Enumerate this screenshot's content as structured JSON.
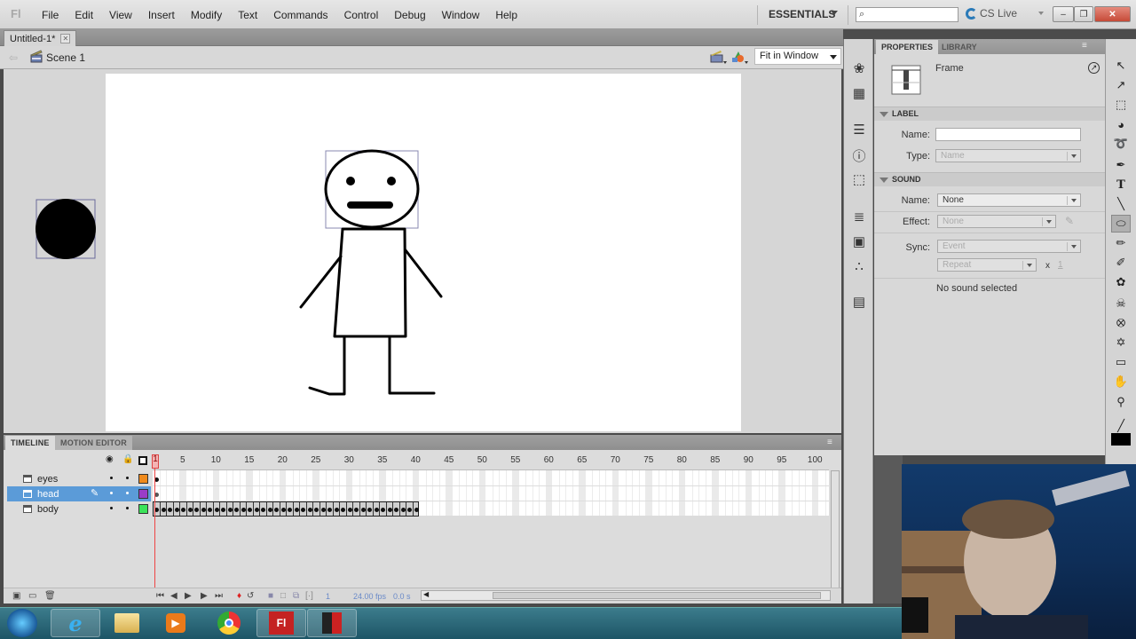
{
  "menubar": {
    "logo": "Fl",
    "items": [
      "File",
      "Edit",
      "View",
      "Insert",
      "Modify",
      "Text",
      "Commands",
      "Control",
      "Debug",
      "Window",
      "Help"
    ],
    "workspace": "ESSENTIALS",
    "search_placeholder": "",
    "cs_live": "CS Live"
  },
  "document": {
    "tab_title": "Untitled-1*",
    "scene": "Scene 1",
    "zoom": "Fit in Window"
  },
  "timeline": {
    "tabs": [
      "TIMELINE",
      "MOTION EDITOR"
    ],
    "ruler_ticks": [
      "1",
      "5",
      "10",
      "15",
      "20",
      "25",
      "30",
      "35",
      "40",
      "45",
      "50",
      "55",
      "60",
      "65",
      "70",
      "75",
      "80",
      "85",
      "90",
      "95",
      "100"
    ],
    "current_frame": 1,
    "layers": [
      {
        "name": "eyes",
        "color": "#f08a1c",
        "selected": false,
        "frames": 1
      },
      {
        "name": "head",
        "color": "#9a3cc8",
        "selected": true,
        "frames": 1
      },
      {
        "name": "body",
        "color": "#3ce35a",
        "selected": false,
        "frames": 40
      }
    ],
    "status": {
      "frame": "1",
      "fps": "24.00 fps",
      "time": "0.0 s"
    }
  },
  "properties": {
    "tabs": [
      "PROPERTIES",
      "LIBRARY"
    ],
    "object_type": "Frame",
    "label_section": "LABEL",
    "label_name_label": "Name:",
    "label_name_value": "",
    "label_type_label": "Type:",
    "label_type_value": "Name",
    "sound_section": "SOUND",
    "sound_name_label": "Name:",
    "sound_name_value": "None",
    "effect_label": "Effect:",
    "effect_value": "None",
    "sync_label": "Sync:",
    "sync_value": "Event",
    "repeat_value": "Repeat",
    "repeat_times_x": "x",
    "repeat_count": "1",
    "sound_status": "No sound selected"
  },
  "dock_icons": [
    "color-swatches-icon",
    "swatches-grid-icon",
    "align-icon",
    "info-icon",
    "transform-icon",
    "code-snippets-icon",
    "components-icon",
    "motion-presets-icon",
    "project-icon"
  ],
  "tools": [
    "selection-tool-icon",
    "subselection-tool-icon",
    "free-transform-tool-icon",
    "3d-rotation-tool-icon",
    "lasso-tool-icon",
    "pen-tool-icon",
    "text-tool-icon",
    "line-tool-icon",
    "oval-tool-icon",
    "pencil-tool-icon",
    "brush-tool-icon",
    "deco-tool-icon",
    "bone-tool-icon",
    "paint-bucket-tool-icon",
    "eyedropper-tool-icon",
    "eraser-tool-icon",
    "hand-tool-icon",
    "zoom-tool-icon",
    "stroke-color-icon",
    "fill-color-icon"
  ],
  "taskbar": {
    "apps": [
      "start-button",
      "internet-explorer",
      "windows-explorer",
      "media-player",
      "google-chrome",
      "adobe-flash",
      "video-recorder"
    ],
    "flash_label": "Fl"
  },
  "colors": {
    "layer_selected": "#5b9bd8",
    "playhead": "#e44444",
    "stage": "#ffffff"
  }
}
